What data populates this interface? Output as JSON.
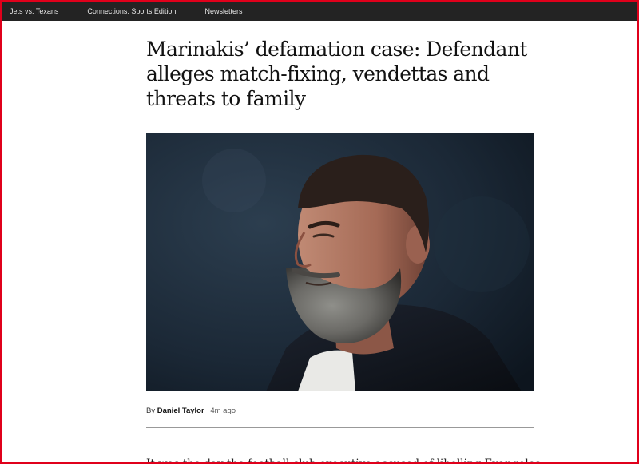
{
  "topnav": {
    "items": [
      {
        "label": "Jets vs. Texans"
      },
      {
        "label": "Connections: Sports Edition"
      },
      {
        "label": "Newsletters"
      }
    ]
  },
  "article": {
    "headline": "Marinakis’ defamation case: Defendant alleges match-fixing, vendettas and threats to family",
    "byline_prefix": "By",
    "author": "Daniel Taylor",
    "timestamp": "4m ago",
    "lede": "It was the day the football club executive accused of libelling Evangelos"
  },
  "colors": {
    "nav_background": "#232323",
    "frame_border": "#e0001b",
    "headline_text": "#121212"
  }
}
